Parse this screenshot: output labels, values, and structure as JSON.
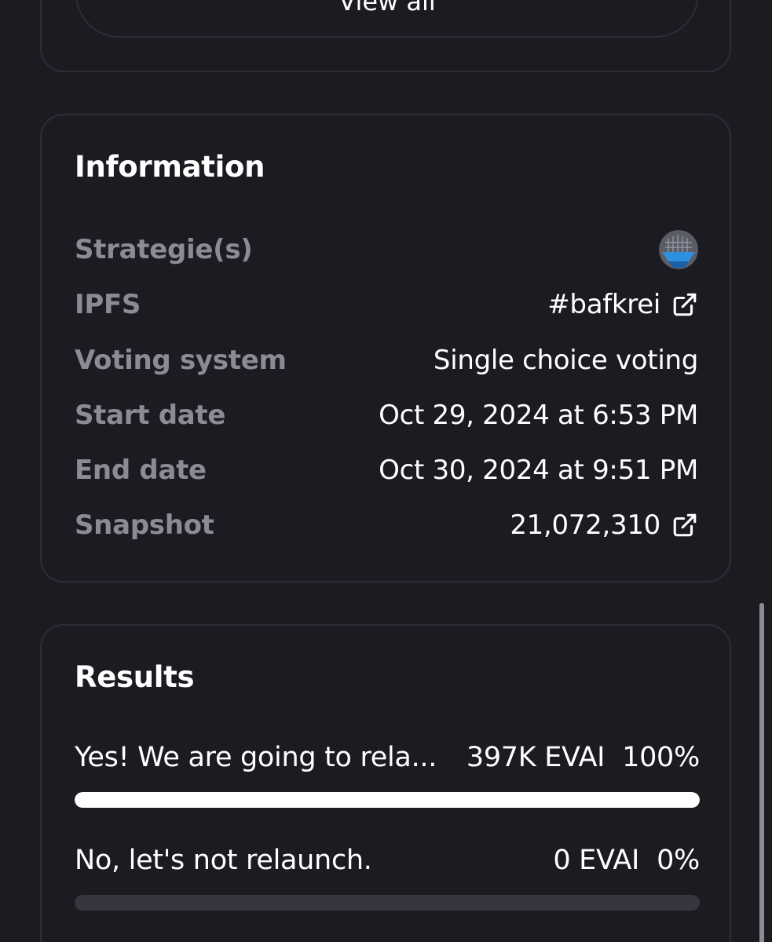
{
  "top_card": {
    "view_all_label": "View all"
  },
  "information": {
    "title": "Information",
    "rows": [
      {
        "label": "Strategie(s)",
        "value": "",
        "icon": "strategy-avatar-icon"
      },
      {
        "label": "IPFS",
        "value": "#bafkrei",
        "icon": "external-link-icon"
      },
      {
        "label": "Voting system",
        "value": "Single choice voting"
      },
      {
        "label": "Start date",
        "value": "Oct 29, 2024 at 6:53 PM"
      },
      {
        "label": "End date",
        "value": "Oct 30, 2024 at 9:51 PM"
      },
      {
        "label": "Snapshot",
        "value": "21,072,310",
        "icon": "external-link-icon"
      }
    ]
  },
  "results": {
    "title": "Results",
    "choices": [
      {
        "label": "Yes! We are going to rela...",
        "amount": "397K EVAI",
        "percent": "100%",
        "fill_fraction": 1.0
      },
      {
        "label": "No, let's not relaunch.",
        "amount": "0 EVAI",
        "percent": "0%",
        "fill_fraction": 0.0
      }
    ]
  },
  "colors": {
    "background": "#1c1b22",
    "border": "#2e2d36",
    "muted_label": "#8b8a96",
    "bar_track": "#37363e",
    "bar_fill": "#ffffff"
  }
}
